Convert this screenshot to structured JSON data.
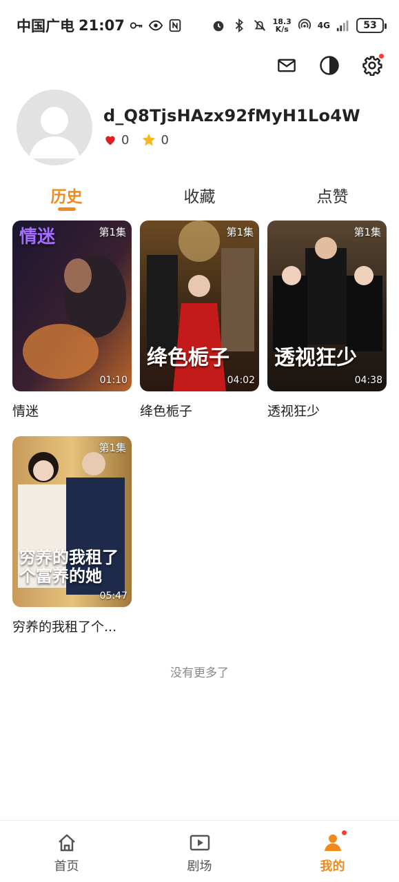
{
  "status_bar": {
    "carrier": "中国广电",
    "time": "21:07",
    "net_speed_value": "18.3",
    "net_speed_unit": "K/s",
    "network": "4G",
    "battery": "53"
  },
  "profile": {
    "username": "d_Q8TjsHAzx92fMyH1Lo4W",
    "likes": "0",
    "favorites": "0"
  },
  "tabs": [
    {
      "label": "历史",
      "active": true
    },
    {
      "label": "收藏",
      "active": false
    },
    {
      "label": "点赞",
      "active": false
    }
  ],
  "items": [
    {
      "title": "情迷",
      "episode": "第1集",
      "duration": "01:10",
      "poster_text": "情迷"
    },
    {
      "title": "绛色栀子",
      "episode": "第1集",
      "duration": "04:02",
      "poster_text": "绛色栀子"
    },
    {
      "title": "透视狂少",
      "episode": "第1集",
      "duration": "04:38",
      "poster_text": "透视狂少"
    },
    {
      "title": "穷养的我租了个...",
      "episode": "第1集",
      "duration": "05:47",
      "poster_text": "穷养的我租了个富养的她"
    }
  ],
  "footer_text": "没有更多了",
  "bottom_nav": [
    {
      "label": "首页",
      "icon": "home-icon",
      "active": false
    },
    {
      "label": "剧场",
      "icon": "play-icon",
      "active": false
    },
    {
      "label": "我的",
      "icon": "user-icon",
      "active": true
    }
  ],
  "colors": {
    "accent": "#f08a1c",
    "badge": "#ff3b30"
  }
}
